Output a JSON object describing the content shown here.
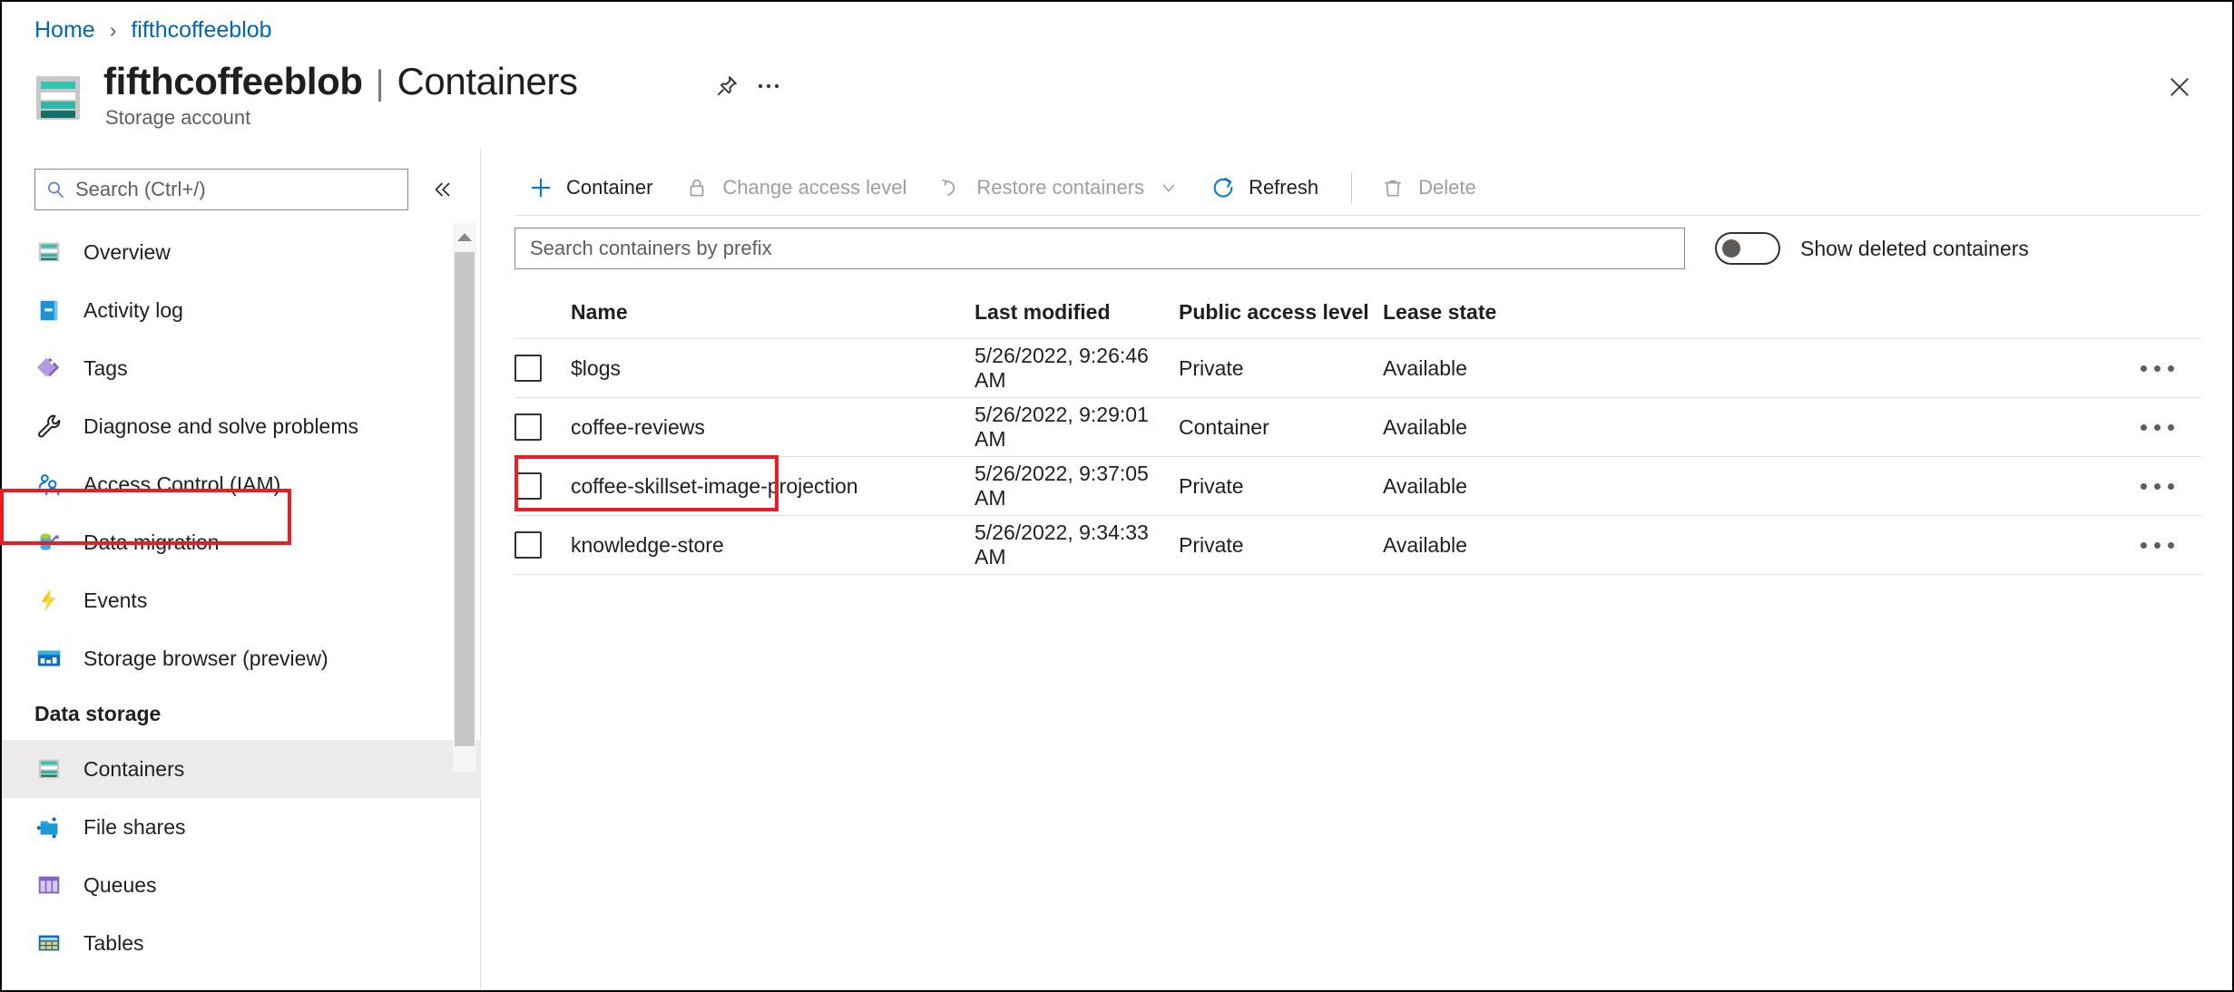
{
  "breadcrumb": {
    "items": [
      {
        "label": "Home"
      },
      {
        "label": "fifthcoffeeblob"
      }
    ],
    "separator": "›"
  },
  "header": {
    "title": "fifthcoffeeblob",
    "divider": "|",
    "section": "Containers",
    "subtitle": "Storage account",
    "pin_icon": "pin-icon",
    "more_icon": "more-actions-icon",
    "close_icon": "close-icon",
    "icon": "storage-account-icon"
  },
  "left_nav": {
    "search_placeholder": "Search (Ctrl+/)",
    "search_icon": "search-icon",
    "collapse_icon": "double-chevron-left-icon",
    "items": [
      {
        "label": "Overview",
        "icon": "overview-icon",
        "selected": false
      },
      {
        "label": "Activity log",
        "icon": "activity-log-icon",
        "selected": false
      },
      {
        "label": "Tags",
        "icon": "tags-icon",
        "selected": false
      },
      {
        "label": "Diagnose and solve problems",
        "icon": "wrench-icon",
        "selected": false
      },
      {
        "label": "Access Control (IAM)",
        "icon": "people-icon",
        "selected": false
      },
      {
        "label": "Data migration",
        "icon": "data-migration-icon",
        "selected": false
      },
      {
        "label": "Events",
        "icon": "lightning-icon",
        "selected": false
      },
      {
        "label": "Storage browser (preview)",
        "icon": "storage-browser-icon",
        "selected": false
      }
    ],
    "group_label": "Data storage",
    "group_items": [
      {
        "label": "Containers",
        "icon": "containers-icon",
        "selected": true,
        "highlighted": true
      },
      {
        "label": "File shares",
        "icon": "file-shares-icon",
        "selected": false,
        "highlighted": false
      },
      {
        "label": "Queues",
        "icon": "queues-icon",
        "selected": false,
        "highlighted": false
      },
      {
        "label": "Tables",
        "icon": "tables-icon",
        "selected": false,
        "highlighted": false
      }
    ]
  },
  "toolbar": {
    "items": [
      {
        "label": "Container",
        "icon": "plus-icon",
        "disabled": false,
        "caret": false
      },
      {
        "label": "Change access level",
        "icon": "lock-icon",
        "disabled": true,
        "caret": false
      },
      {
        "label": "Restore containers",
        "icon": "undo-icon",
        "disabled": true,
        "caret": true
      },
      {
        "label": "Refresh",
        "icon": "refresh-icon",
        "disabled": false,
        "caret": false
      },
      {
        "label": "Delete",
        "icon": "trash-icon",
        "disabled": true,
        "caret": false
      }
    ]
  },
  "filter": {
    "search_placeholder": "Search containers by prefix",
    "toggle_label": "Show deleted containers",
    "toggle_on": false
  },
  "table": {
    "columns": [
      "Name",
      "Last modified",
      "Public access level",
      "Lease state"
    ],
    "rows": [
      {
        "name": "$logs",
        "last_modified": "5/26/2022, 9:26:46 AM",
        "public_access_level": "Private",
        "lease_state": "Available",
        "checked": false,
        "highlighted": false
      },
      {
        "name": "coffee-reviews",
        "last_modified": "5/26/2022, 9:29:01 AM",
        "public_access_level": "Container",
        "lease_state": "Available",
        "checked": false,
        "highlighted": false
      },
      {
        "name": "coffee-skillset-image-projection",
        "last_modified": "5/26/2022, 9:37:05 AM",
        "public_access_level": "Private",
        "lease_state": "Available",
        "checked": false,
        "highlighted": true
      },
      {
        "name": "knowledge-store",
        "last_modified": "5/26/2022, 9:34:33 AM",
        "public_access_level": "Private",
        "lease_state": "Available",
        "checked": false,
        "highlighted": false
      }
    ],
    "row_more_icon": "more-options-icon"
  },
  "colors": {
    "link": "#0067b8",
    "highlight": "#ec1c24",
    "accent_teal": "#31c4b4",
    "selected_row_bg": "#edebe9"
  }
}
